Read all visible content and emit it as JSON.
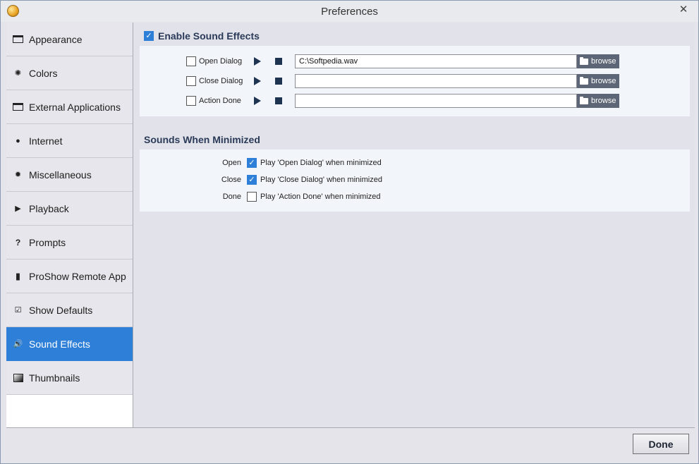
{
  "window": {
    "title": "Preferences",
    "close_glyph": "✕"
  },
  "sidebar": {
    "items": [
      {
        "label": "Appearance",
        "icon": "window-icon"
      },
      {
        "label": "Colors",
        "icon": "colors-icon"
      },
      {
        "label": "External Applications",
        "icon": "external-app-icon"
      },
      {
        "label": "Internet",
        "icon": "globe-icon"
      },
      {
        "label": "Miscellaneous",
        "icon": "gear-icon"
      },
      {
        "label": "Playback",
        "icon": "play-icon"
      },
      {
        "label": "Prompts",
        "icon": "question-icon"
      },
      {
        "label": "ProShow Remote App",
        "icon": "remote-icon"
      },
      {
        "label": "Show Defaults",
        "icon": "checkbox-icon"
      },
      {
        "label": "Sound Effects",
        "icon": "speaker-icon",
        "active": true
      },
      {
        "label": "Thumbnails",
        "icon": "thumbnail-icon"
      }
    ]
  },
  "sound_effects": {
    "enable_label": "Enable Sound Effects",
    "enabled": true,
    "rows": [
      {
        "label": "Open Dialog",
        "checked": false,
        "path": "C:\\Softpedia.wav",
        "browse": "browse"
      },
      {
        "label": "Close Dialog",
        "checked": false,
        "path": "",
        "browse": "browse"
      },
      {
        "label": "Action Done",
        "checked": false,
        "path": "",
        "browse": "browse"
      }
    ]
  },
  "minimized": {
    "title": "Sounds When Minimized",
    "rows": [
      {
        "label": "Open",
        "text": "Play 'Open Dialog' when minimized",
        "checked": true
      },
      {
        "label": "Close",
        "text": "Play 'Close Dialog' when minimized",
        "checked": true
      },
      {
        "label": "Done",
        "text": "Play 'Action Done' when minimized",
        "checked": false
      }
    ]
  },
  "footer": {
    "done_label": "Done"
  },
  "colors": {
    "accent": "#2d7fd8",
    "transport": "#1e3350",
    "browse_bg": "#5d6676"
  }
}
